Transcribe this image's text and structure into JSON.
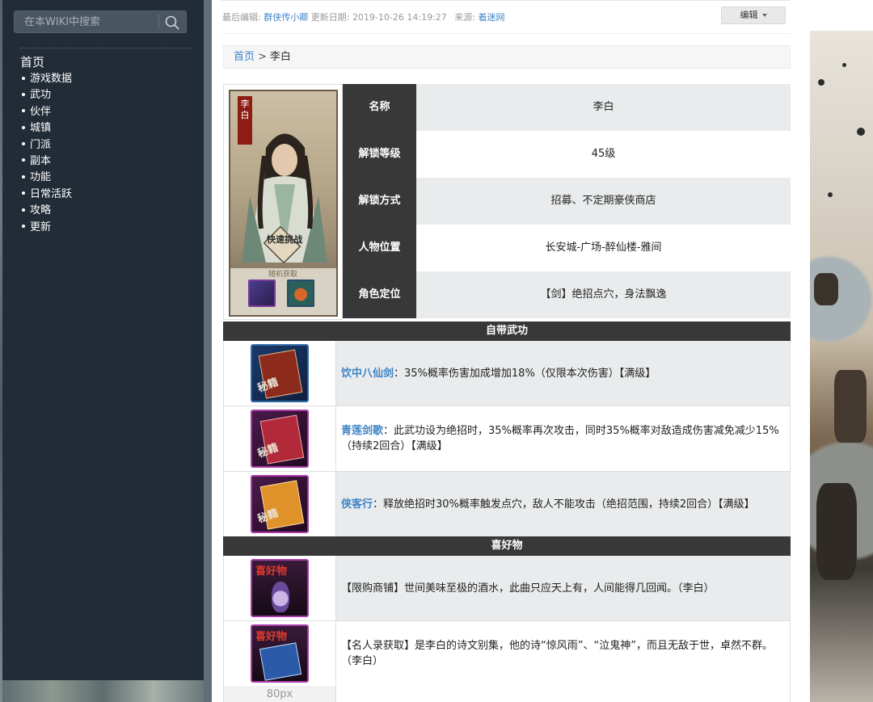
{
  "sidebar": {
    "search_placeholder": "在本WIKI中搜索",
    "home": "首页",
    "items": [
      "游戏数据",
      "武功",
      "伙伴",
      "城镇",
      "门派",
      "副本",
      "功能",
      "日常活跃",
      "攻略",
      "更新"
    ]
  },
  "meta": {
    "editor_label": "最后编辑:",
    "editor": "群侠传小卿",
    "date_label": "更新日期:",
    "date": "2019-10-26 14:19:27",
    "source_label": "来源:",
    "source": "着迷网",
    "edit_button": "编辑"
  },
  "breadcrumb": {
    "home": "首页",
    "sep": ">",
    "current": "李白"
  },
  "card": {
    "name": "李白",
    "badge": "快速挑战",
    "label": "随机获取"
  },
  "info": [
    {
      "key": "名称",
      "value": "李白"
    },
    {
      "key": "解锁等级",
      "value": "45级"
    },
    {
      "key": "解锁方式",
      "value": "招募、不定期豪侠商店"
    },
    {
      "key": "人物位置",
      "value": "长安城-广场-醉仙楼-雅间"
    },
    {
      "key": "角色定位",
      "value": "【剑】绝招点穴，身法飘逸"
    }
  ],
  "skills": {
    "title": "自带武功",
    "items": [
      {
        "name": "饮中八仙剑",
        "desc": "：35%概率伤害加成增加18%（仅限本次伤害）【满级】",
        "icon_text": "秘籍",
        "color": "#8c2a1c"
      },
      {
        "name": "青莲剑歌",
        "desc": "：此武功设为绝招时，35%概率再次攻击，同时35%概率对敌造成伤害减免减少15%（持续2回合）【满级】",
        "icon_text": "秘籍",
        "color": "#b22a3a"
      },
      {
        "name": "侠客行",
        "desc": "：释放绝招时30%概率触发点穴，敌人不能攻击（绝招范围，持续2回合）【满级】",
        "icon_text": "秘籍",
        "color": "#d8821c"
      }
    ]
  },
  "gifts": {
    "title": "喜好物",
    "items": [
      {
        "desc": "【限购商铺】世间美味至极的酒水，此曲只应天上有，人间能得几回闻。（李白）",
        "icon_text": "喜好物",
        "color": "#5a3a9a"
      },
      {
        "desc": "【名人录获取】是李白的诗文别集，他的诗“惊风雨”、“泣鬼神”，而且无敌于世，卓然不群。（李白）",
        "icon_text": "喜好物",
        "color": "#2a5aa8"
      }
    ]
  },
  "footer_cell": "80px"
}
